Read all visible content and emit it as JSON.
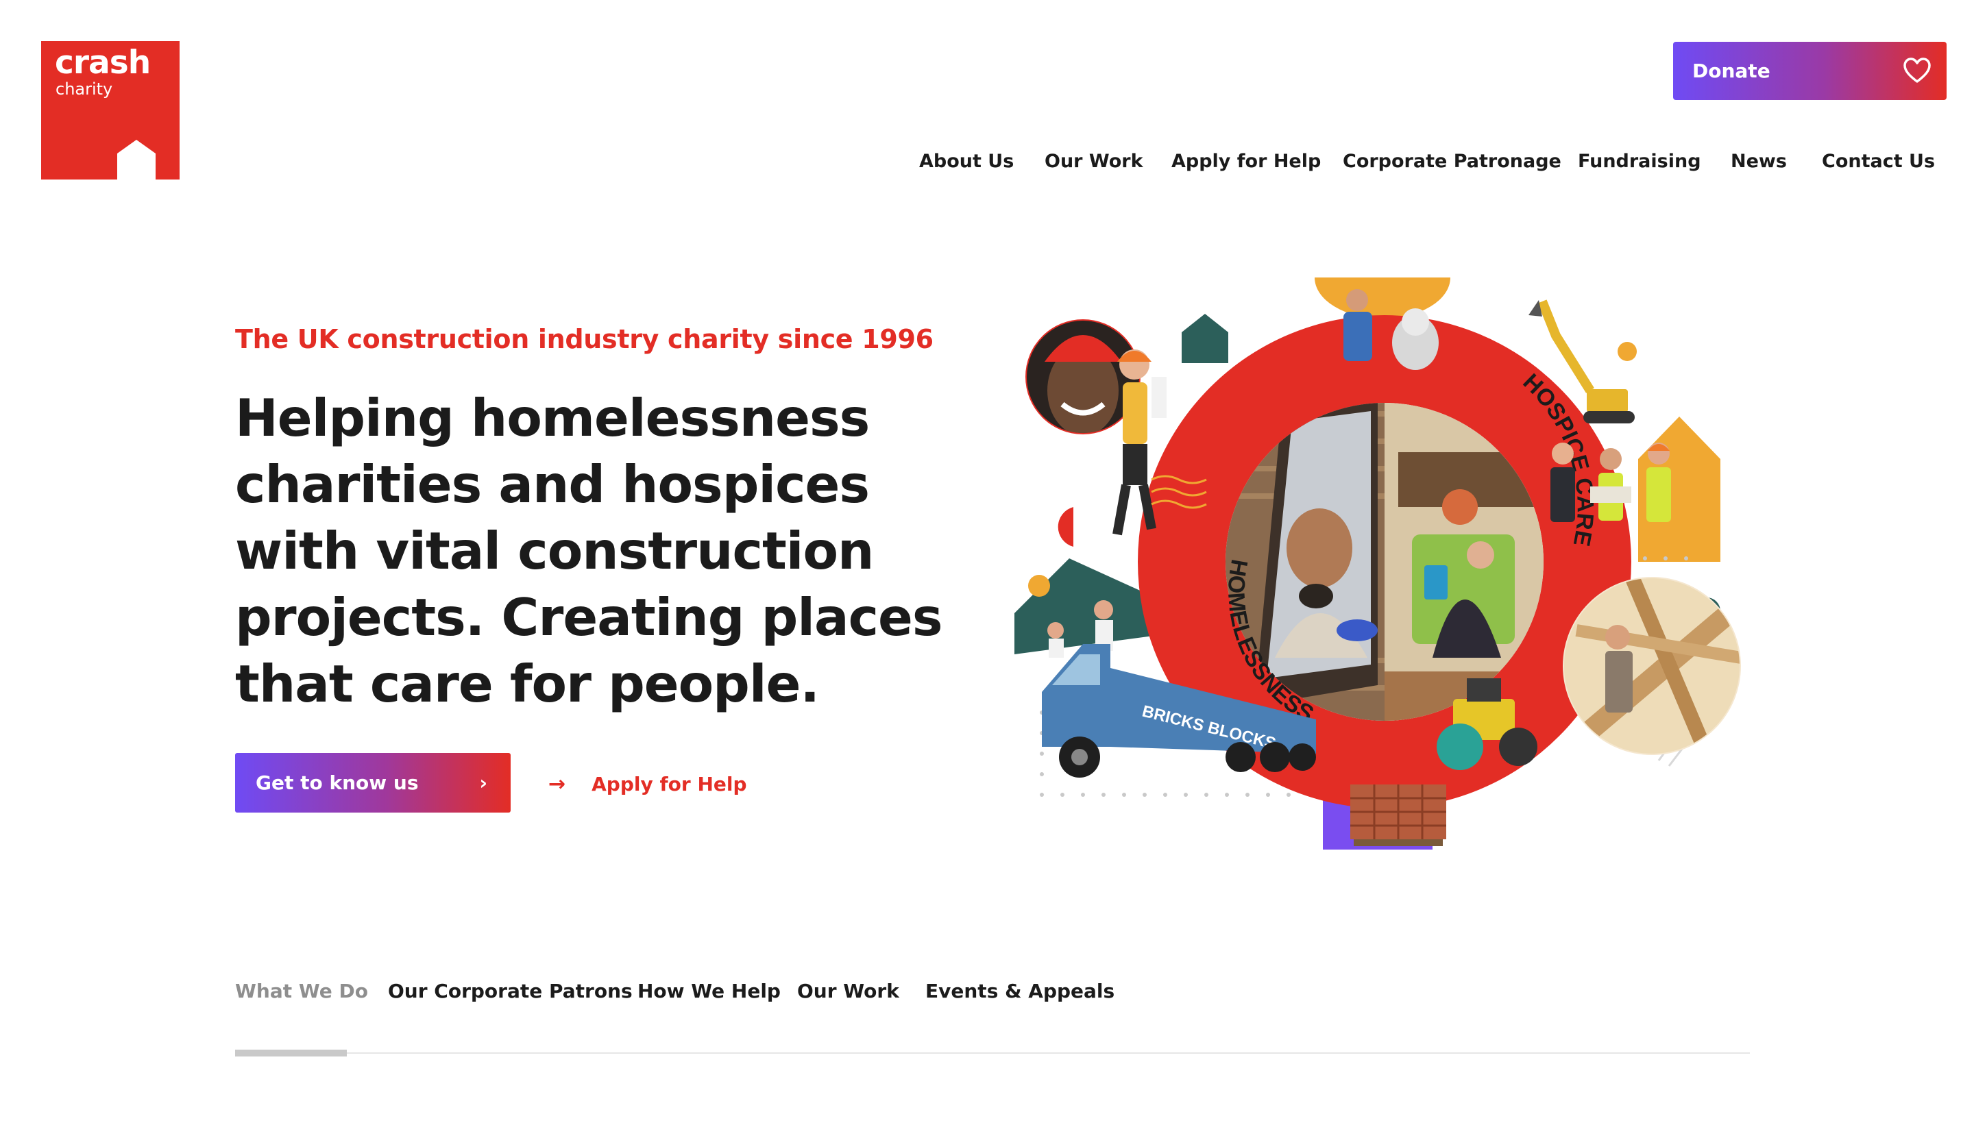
{
  "brand": {
    "name": "crash",
    "tagline": "charity",
    "color": "#e32d25",
    "logo_icon": "house-icon"
  },
  "header": {
    "donate_label": "Donate",
    "donate_icon": "heart-outline-icon",
    "nav": [
      "About Us",
      "Our Work",
      "Apply for Help",
      "Corporate Patronage",
      "Fundraising",
      "News",
      "Contact Us"
    ]
  },
  "hero": {
    "eyebrow": "The UK construction industry charity since 1996",
    "headline": "Helping homelessness charities and hospices with vital construction projects. Creating places that care for people.",
    "primary_cta": "Get to know us",
    "primary_cta_icon": "chevron-right-icon",
    "secondary_cta": "Apply for Help",
    "secondary_cta_icon": "arrow-right-icon",
    "collage": {
      "ring_label_left": "HOMELESSNESS",
      "ring_label_right": "HOSPICE CARE",
      "truck_text": "BRICKS BLOCKS"
    }
  },
  "tabs": {
    "items": [
      "What We Do",
      "Our Corporate Patrons",
      "How We Help",
      "Our Work",
      "Events & Appeals"
    ],
    "active_index": 0
  },
  "colors": {
    "brand_red": "#e32d25",
    "gradient_start": "#6f4bf4",
    "text_dark": "#1b1b1b",
    "tab_inactive_grey": "#8e8e8e",
    "accent_orange": "#f0a832",
    "accent_teal": "#2c5f5a",
    "accent_purple": "#7a4df0"
  }
}
